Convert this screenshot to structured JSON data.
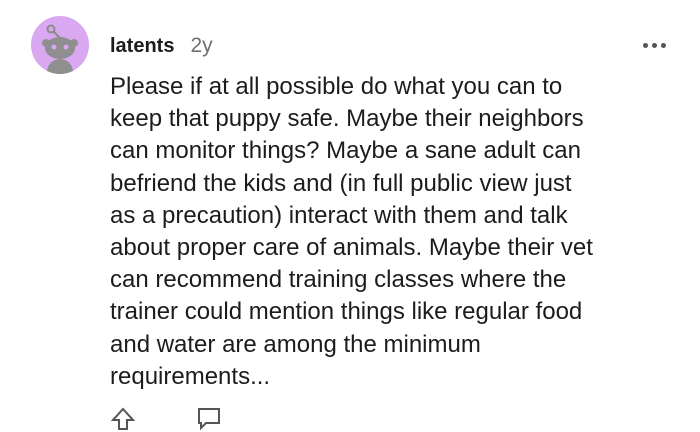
{
  "comment": {
    "username": "latents",
    "timestamp": "2y",
    "body": "Please if at all possible do what you can to\nkeep that puppy safe. Maybe their neighbors\ncan monitor things? Maybe a sane adult can\nbefriend the kids and (in full public view just\nas a precaution) interact with them and talk\nabout proper care of animals. Maybe their vet\ncan recommend training classes where the\ntrainer could mention things like regular food\nand water are among the minimum\nrequirements...",
    "avatar_icon": "snoo-avatar-icon",
    "avatar_color": "#d9a8f0",
    "more_icon": "more-options-icon",
    "actions": [
      {
        "icon": "upvote-icon"
      },
      {
        "icon": "reply-icon"
      }
    ]
  }
}
